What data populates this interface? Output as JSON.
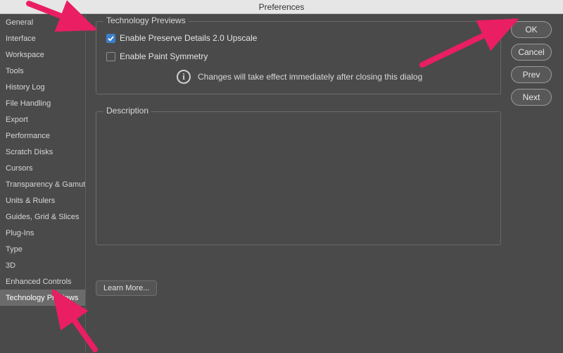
{
  "window": {
    "title": "Preferences"
  },
  "sidebar": {
    "items": [
      {
        "label": "General"
      },
      {
        "label": "Interface"
      },
      {
        "label": "Workspace"
      },
      {
        "label": "Tools"
      },
      {
        "label": "History Log"
      },
      {
        "label": "File Handling"
      },
      {
        "label": "Export"
      },
      {
        "label": "Performance"
      },
      {
        "label": "Scratch Disks"
      },
      {
        "label": "Cursors"
      },
      {
        "label": "Transparency & Gamut"
      },
      {
        "label": "Units & Rulers"
      },
      {
        "label": "Guides, Grid & Slices"
      },
      {
        "label": "Plug-Ins"
      },
      {
        "label": "Type"
      },
      {
        "label": "3D"
      },
      {
        "label": "Enhanced Controls"
      },
      {
        "label": "Technology Previews"
      }
    ],
    "selected_index": 17
  },
  "panel": {
    "title": "Technology Previews",
    "options": [
      {
        "label": "Enable Preserve Details 2.0 Upscale",
        "checked": true
      },
      {
        "label": "Enable Paint Symmetry",
        "checked": false
      }
    ],
    "info": "Changes will take effect immediately after closing this dialog",
    "description_title": "Description",
    "learn_more": "Learn More..."
  },
  "buttons": {
    "ok": "OK",
    "cancel": "Cancel",
    "prev": "Prev",
    "next": "Next"
  },
  "annotation": {
    "color": "#e91e63"
  }
}
